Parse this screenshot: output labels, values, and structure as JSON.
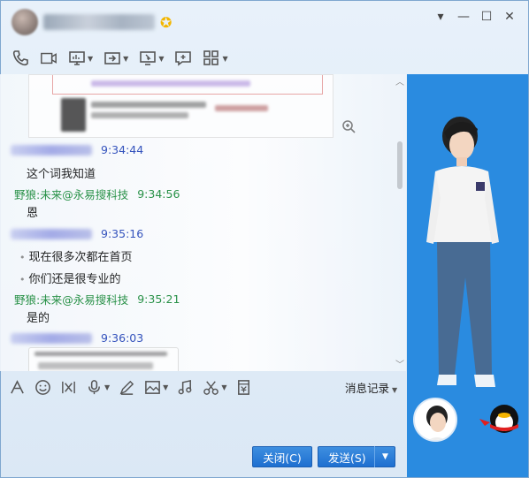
{
  "window": {
    "minimize": "—",
    "maximize": "☐",
    "close": "✕",
    "dropdown": "▾"
  },
  "messages": [
    {
      "time": "9:34:44"
    },
    {
      "text": "这个词我知道"
    },
    {
      "sender": "野狼:未来@永易搜科技",
      "time": "9:34:56"
    },
    {
      "text": "恩"
    },
    {
      "time": "9:35:16"
    },
    {
      "text": "现在很多次都在首页"
    },
    {
      "text": "你们还是很专业的"
    },
    {
      "sender": "野狼:未来@永易搜科技",
      "time": "9:35:21"
    },
    {
      "text": "是的"
    },
    {
      "time": "9:36:03"
    }
  ],
  "input_toolbar": {
    "history_label": "消息记录"
  },
  "buttons": {
    "close": "关闭(C)",
    "send": "发送(S)"
  },
  "colors": {
    "accent": "#1e6fd0",
    "side_panel": "#2a8be0",
    "self_name": "#1a8a3a",
    "other_time": "#2646b8"
  },
  "icons": [
    "phone-icon",
    "video-icon",
    "screen-share-icon",
    "file-transfer-icon",
    "remote-assist-icon",
    "comment-icon",
    "apps-icon",
    "font-icon",
    "emoji-icon",
    "gif-icon",
    "voice-icon",
    "pen-icon",
    "image-icon",
    "music-icon",
    "scissors-icon",
    "red-packet-icon",
    "zoom-in-icon",
    "qq-penguin-icon"
  ]
}
